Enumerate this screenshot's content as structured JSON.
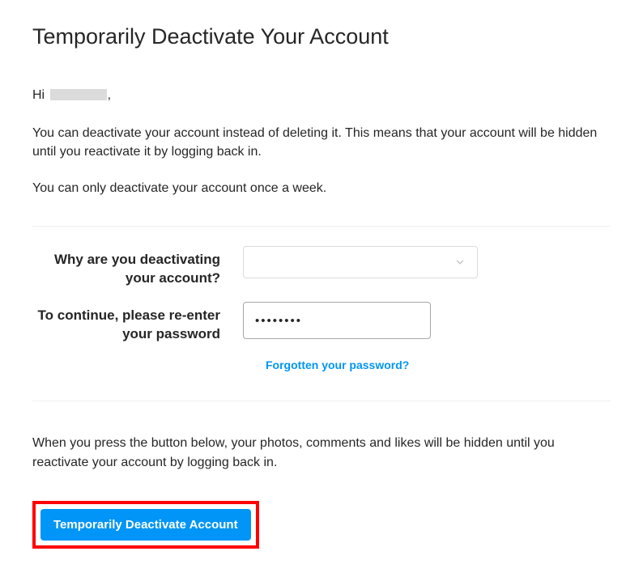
{
  "title": "Temporarily Deactivate Your Account",
  "greeting": {
    "prefix": "Hi",
    "suffix": ","
  },
  "para1": "You can deactivate your account instead of deleting it. This means that your account will be hidden until you reactivate it by logging back in.",
  "para2": "You can only deactivate your account once a week.",
  "fields": {
    "reason_label": "Why are you deactivating your account?",
    "reason_value": "",
    "password_label": "To continue, please re-enter your password",
    "password_value": "••••••••"
  },
  "forgot_link": "Forgotten your password?",
  "bottom_para": "When you press the button below, your photos, comments and likes will be hidden until you reactivate your account by logging back in.",
  "deactivate_button": "Temporarily Deactivate Account"
}
